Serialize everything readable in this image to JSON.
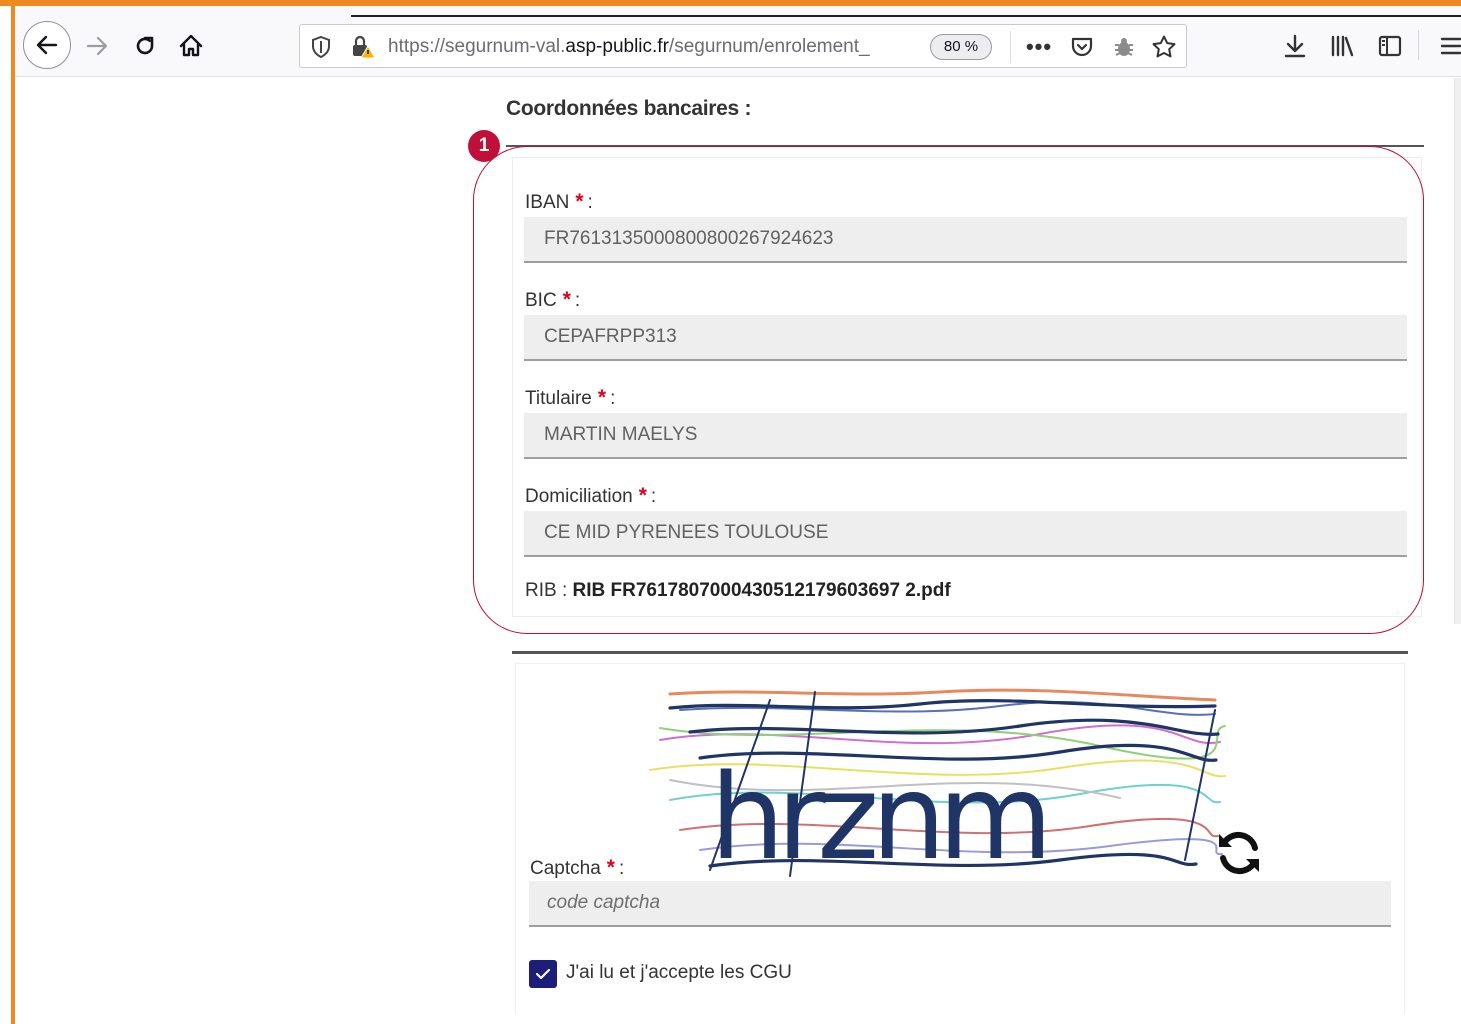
{
  "browser": {
    "url_prefix": "https://segurnum-val.",
    "url_domain": "asp-public.fr",
    "url_path": "/segurnum/enrolement_",
    "zoom": "80 %",
    "more_label": "•••"
  },
  "annotation": {
    "marker": "1"
  },
  "bank": {
    "title": "Coordonnées bancaires :",
    "required_mark": "*",
    "iban": {
      "label": "IBAN",
      "suffix": ":",
      "value": "FR7613135000800800267924623"
    },
    "bic": {
      "label": "BIC",
      "suffix": ":",
      "value": "CEPAFRPP313"
    },
    "titulaire": {
      "label": "Titulaire",
      "suffix": ":",
      "value": "MARTIN MAELYS"
    },
    "domiciliation": {
      "label": "Domiciliation",
      "suffix": ":",
      "value": "CE MID PYRENEES TOULOUSE"
    },
    "rib": {
      "label": "RIB :",
      "file": "RIB FR7617807000430512179603697 2.pdf"
    }
  },
  "captcha": {
    "image_text": "hrznm",
    "label": "Captcha",
    "required_mark": "*",
    "suffix": ":",
    "placeholder": "code captcha"
  },
  "cgu": {
    "label": "J'ai lu et j'accepte les CGU",
    "checked": true
  },
  "colors": {
    "accent_frame": "#ee8a1f",
    "highlight": "#b5132f",
    "required": "#e1001a",
    "checkbox": "#1d1d7a",
    "captcha_text": "#1f3566"
  }
}
